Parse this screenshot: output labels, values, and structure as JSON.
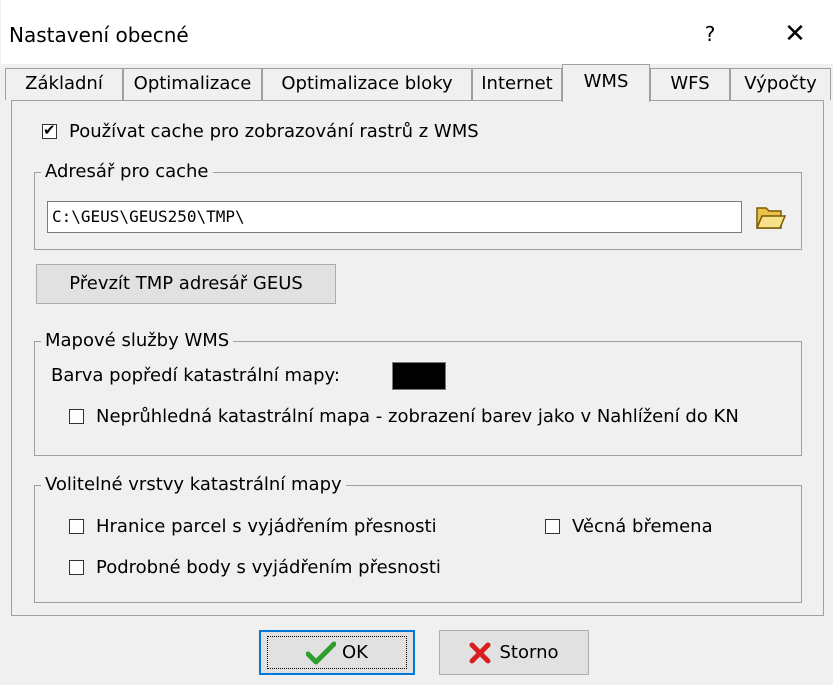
{
  "window": {
    "title": "Nastavení obecné",
    "help_label": "?",
    "close_label": "✕"
  },
  "tabs": [
    {
      "label": "Základní",
      "active": false
    },
    {
      "label": "Optimalizace",
      "active": false
    },
    {
      "label": "Optimalizace bloky",
      "active": false
    },
    {
      "label": "Internet",
      "active": false
    },
    {
      "label": "WMS",
      "active": true
    },
    {
      "label": "WFS",
      "active": false
    },
    {
      "label": "Výpočty",
      "active": false
    }
  ],
  "wms": {
    "use_cache": {
      "label": "Používat cache pro zobrazování rastrů z WMS",
      "checked": true
    },
    "cache_group": {
      "title": "Adresář pro cache",
      "path_value": "C:\\GEUS\\GEUS250\\TMP\\",
      "browse_icon": "folder-open-icon"
    },
    "take_tmp_button": "Převzít TMP adresář GEUS",
    "services_group": {
      "title": "Mapové služby WMS",
      "foreground_color_label": "Barva popředí katastrální mapy:",
      "foreground_color": "#000000",
      "opaque_map": {
        "label": "Neprůhledná katastrální mapa - zobrazení barev jako v Nahlížení do KN",
        "checked": false
      }
    },
    "layers_group": {
      "title": "Volitelné vrstvy katastrální mapy",
      "parcel_boundaries": {
        "label": "Hranice parcel s vyjádřením přesnosti",
        "checked": false
      },
      "easements": {
        "label": "Věcná břemena",
        "checked": false
      },
      "detail_points": {
        "label": "Podrobné body s vyjádřením přesnosti",
        "checked": false
      }
    }
  },
  "footer": {
    "ok_label": "OK",
    "ok_icon": "checkmark-icon",
    "ok_icon_color": "#2e9e2e",
    "cancel_label": "Storno",
    "cancel_icon": "cross-icon",
    "cancel_icon_color": "#d81e1e"
  }
}
